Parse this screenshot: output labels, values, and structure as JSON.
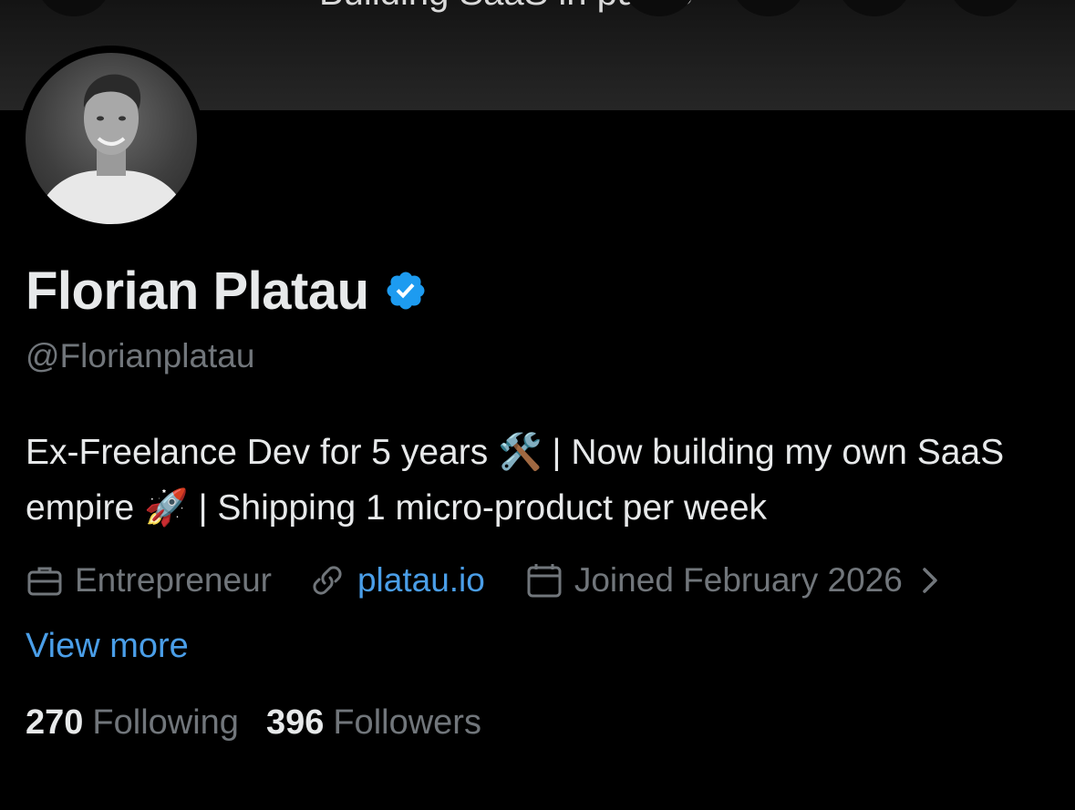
{
  "banner": {
    "text": "Building SaaS in public"
  },
  "profile": {
    "name": "Florian Platau",
    "handle": "@Florianplatau",
    "bio": "Ex-Freelance Dev for 5 years 🛠️ | Now building my own SaaS empire 🚀 | Shipping 1 micro-product per week",
    "verified": true,
    "verified_color": "#1d9bf0"
  },
  "meta": {
    "category": "Entrepreneur",
    "category_icon": "briefcase-icon",
    "website": "platau.io",
    "website_icon": "link-icon",
    "joined": "Joined February 2026",
    "joined_icon": "calendar-icon"
  },
  "actions": {
    "view_more": "View more"
  },
  "stats": {
    "following_count": "270",
    "following_label": "Following",
    "followers_count": "396",
    "followers_label": "Followers"
  },
  "colors": {
    "background": "#000000",
    "primary_text": "#e7e9ea",
    "secondary_text": "#71767b",
    "link": "#4a9ee8"
  }
}
